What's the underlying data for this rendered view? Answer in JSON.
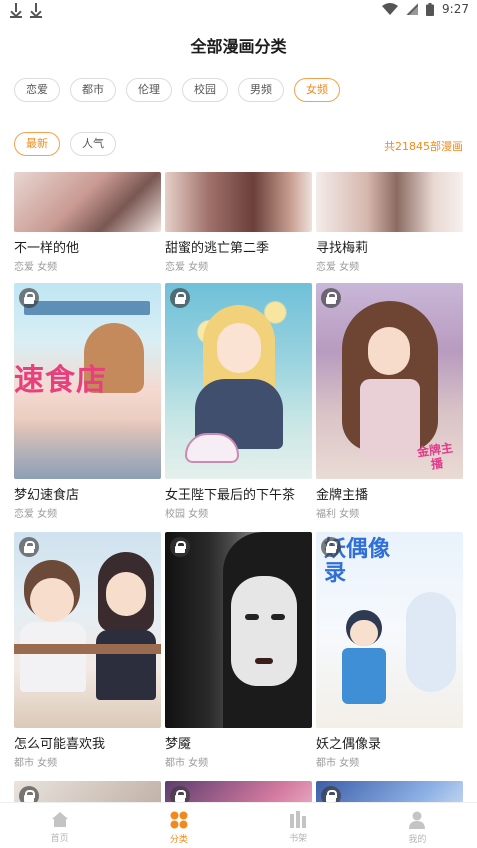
{
  "status_bar": {
    "time": "9:27"
  },
  "page_title": "全部漫画分类",
  "categories": [
    {
      "label": "恋爱",
      "active": false
    },
    {
      "label": "都市",
      "active": false
    },
    {
      "label": "伦理",
      "active": false
    },
    {
      "label": "校园",
      "active": false
    },
    {
      "label": "男频",
      "active": false
    },
    {
      "label": "女频",
      "active": true
    }
  ],
  "sort": [
    {
      "label": "最新",
      "active": true
    },
    {
      "label": "人气",
      "active": false
    }
  ],
  "total_count": "共21845部漫画",
  "comics": [
    {
      "title": "不一样的他",
      "tags": "恋爱 女频",
      "locked": false
    },
    {
      "title": "甜蜜的逃亡第二季",
      "tags": "恋爱 女频",
      "locked": false
    },
    {
      "title": "寻找梅莉",
      "tags": "恋爱 女频",
      "locked": false
    },
    {
      "title": "梦幻速食店",
      "tags": "恋爱 女频",
      "locked": true,
      "cover_text": "速食店"
    },
    {
      "title": "女王陛下最后的下午茶",
      "tags": "校园 女频",
      "locked": true
    },
    {
      "title": "金牌主播",
      "tags": "福利 女频",
      "locked": true,
      "cover_text": "金牌主播"
    },
    {
      "title": "怎么可能喜欢我",
      "tags": "都市 女频",
      "locked": true
    },
    {
      "title": "梦魇",
      "tags": "都市 女频",
      "locked": true
    },
    {
      "title": "妖之偶像录",
      "tags": "都市 女频",
      "locked": true,
      "cover_text": "妖偶像录"
    },
    {
      "title": "",
      "tags": "",
      "locked": true
    },
    {
      "title": "",
      "tags": "",
      "locked": true
    },
    {
      "title": "",
      "tags": "",
      "locked": true
    }
  ],
  "tabs": [
    {
      "label": "首页",
      "icon": "home-icon",
      "active": false
    },
    {
      "label": "分类",
      "icon": "category-icon",
      "active": true
    },
    {
      "label": "书架",
      "icon": "bookshelf-icon",
      "active": false
    },
    {
      "label": "我的",
      "icon": "profile-icon",
      "active": false
    }
  ],
  "colors": {
    "accent": "#f08a1c"
  }
}
